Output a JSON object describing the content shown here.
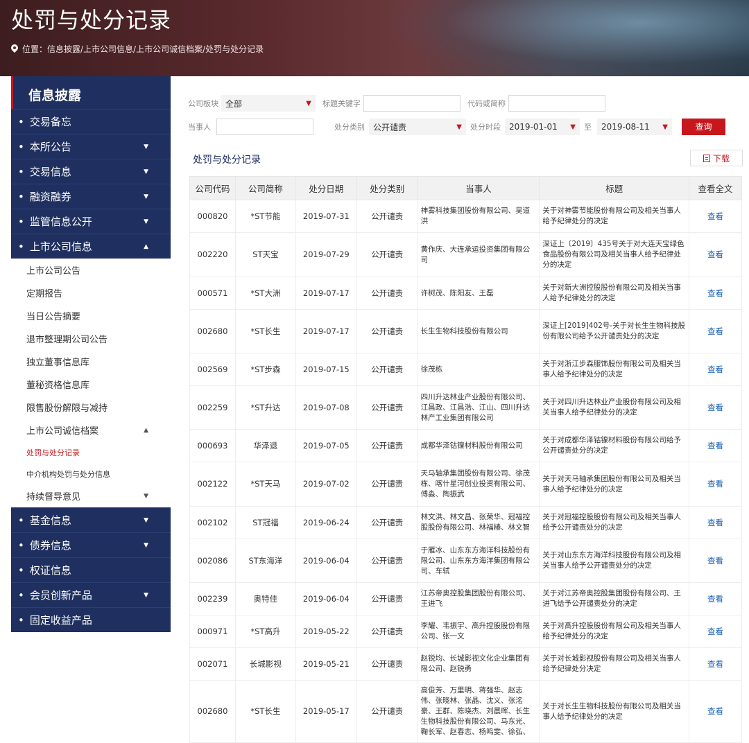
{
  "header": {
    "title": "处罚与处分记录",
    "breadcrumb": "位置：信息披露/上市公司信息/上市公司诚信档案/处罚与处分记录"
  },
  "sidebar": {
    "heading": "信息披露",
    "items": [
      {
        "label": "交易备忘",
        "caret": ""
      },
      {
        "label": "本所公告",
        "caret": "▼"
      },
      {
        "label": "交易信息",
        "caret": "▼"
      },
      {
        "label": "融资融券",
        "caret": "▼"
      },
      {
        "label": "监管信息公开",
        "caret": "▼"
      },
      {
        "label": "上市公司信息",
        "caret": "▲"
      }
    ],
    "subitems": [
      "上市公司公告",
      "定期报告",
      "当日公告摘要",
      "退市整理期公司公告",
      "独立董事信息库",
      "董秘资格信息库",
      "限售股份解限与减持"
    ],
    "integrity": {
      "label": "上市公司诚信档案",
      "caret": "▲"
    },
    "integrity_children": [
      "处罚与处分记录",
      "中介机构处罚与处分信息"
    ],
    "supervision": {
      "label": "持续督导意见",
      "caret": "▼"
    },
    "bottom_items": [
      {
        "label": "基金信息",
        "caret": "▼"
      },
      {
        "label": "债券信息",
        "caret": "▼"
      },
      {
        "label": "权证信息",
        "caret": ""
      },
      {
        "label": "会员创新产品",
        "caret": "▼"
      },
      {
        "label": "固定收益产品",
        "caret": ""
      }
    ]
  },
  "filters": {
    "board_label": "公司板块",
    "board_value": "全部",
    "keyword_label": "标题关键字",
    "code_label": "代码或简称",
    "party_label": "当事人",
    "type_label": "处分类别",
    "type_value": "公开谴责",
    "period_label": "处分时段",
    "date_from": "2019-01-01",
    "to_label": "至",
    "date_to": "2019-08-11",
    "query_label": "查询",
    "arrow": "▼"
  },
  "section": {
    "title": "处罚与处分记录",
    "download_label": "下载"
  },
  "table": {
    "headers": [
      "公司代码",
      "公司简称",
      "处分日期",
      "处分类别",
      "当事人",
      "标题",
      "查看全文"
    ],
    "rows": [
      [
        "000820",
        "*ST节能",
        "2019-07-31",
        "公开谴责",
        "神雾科技集团股份有限公司、吴道洪",
        "关于对神雾节能股份有限公司及相关当事人给予纪律处分的决定",
        "查看"
      ],
      [
        "002220",
        "ST天宝",
        "2019-07-29",
        "公开谴责",
        "黄作庆、大连承运投资集团有限公司",
        "深证上〔2019〕435号关于对大连天宝绿色食品股份有限公司及相关当事人给予纪律处分的决定",
        "查看"
      ],
      [
        "000571",
        "*ST大洲",
        "2019-07-17",
        "公开谴责",
        "许树茂、陈阳友、王磊",
        "关于对新大洲控股股份有限公司及相关当事人给予纪律处分的决定",
        "查看"
      ],
      [
        "002680",
        "*ST长生",
        "2019-07-17",
        "公开谴责",
        "长生生物科技股份有限公司",
        "深证上[2019]402号-关于对长生生物科技股份有限公司给予公开谴责处分的决定",
        "查看"
      ],
      [
        "002569",
        "*ST步森",
        "2019-07-15",
        "公开谴责",
        "徐茂栋",
        "关于对浙江步森服饰股份有限公司及相关当事人给予纪律处分的决定",
        "查看"
      ],
      [
        "002259",
        "*ST升达",
        "2019-07-08",
        "公开谴责",
        "四川升达林业产业股份有限公司、江昌政、江昌浩、江山、四川升达林产工业集团有限公司",
        "关于对四川升达林业产业股份有限公司及相关当事人给予纪律处分的决定",
        "查看"
      ],
      [
        "000693",
        "华泽退",
        "2019-07-05",
        "公开谴责",
        "成都华泽钴镍材料股份有限公司",
        "关于对成都华泽钴镍材料股份有限公司给予公开谴责处分的决定",
        "查看"
      ],
      [
        "002122",
        "*ST天马",
        "2019-07-02",
        "公开谴责",
        "天马轴承集团股份有限公司、徐茂栋、喀什星河创业投资有限公司、傅淼、陶振武",
        "关于对天马轴承集团股份有限公司及相关当事人给予纪律处分的决定",
        "查看"
      ],
      [
        "002102",
        "ST冠福",
        "2019-06-24",
        "公开谴责",
        "林文洪、林文昌、张荣华、冠福控股股份有限公司、林福椿、林文智",
        "关于对冠福控股股份有限公司及相关当事人给予公开谴责处分的决定",
        "查看"
      ],
      [
        "002086",
        "ST东海洋",
        "2019-06-04",
        "公开谴责",
        "于雁冰、山东东方海洋科技股份有限公司、山东东方海洋集团有限公司、车轼",
        "关于对山东东方海洋科技股份有限公司及相关当事人给予公开谴责处分的决定",
        "查看"
      ],
      [
        "002239",
        "奥特佳",
        "2019-06-04",
        "公开谴责",
        "江苏帝奥控股集团股份有限公司、王进飞",
        "关于对江苏帝奥控股集团股份有限公司、王进飞给予公开谴责处分的决定",
        "查看"
      ],
      [
        "000971",
        "*ST高升",
        "2019-05-22",
        "公开谴责",
        "李耀、韦振宇、高升控股股份有限公司、张一文",
        "关于对高升控股股份有限公司及相关当事人给予纪律处分的决定",
        "查看"
      ],
      [
        "002071",
        "长城影视",
        "2019-05-21",
        "公开谴责",
        "赵锐均、长城影视文化企业集团有限公司、赵锐勇",
        "关于对长城影视股份有限公司及相关当事人给予纪律处分决定",
        "查看"
      ],
      [
        "002680",
        "*ST长生",
        "2019-05-17",
        "公开谴责",
        "高俊芳、万里明、蒋强华、赵志伟、张晓林、张晶、沈义、张洺豪、王群、陈晓杰、刘晨晖、长生生物科技股份有限公司、马东光、鞠长军、赵春志、杨鸣雯、徐弘、",
        "关于对长生生物科技股份有限公司及相关当事人给予纪律处分的决定",
        "查看"
      ]
    ]
  }
}
